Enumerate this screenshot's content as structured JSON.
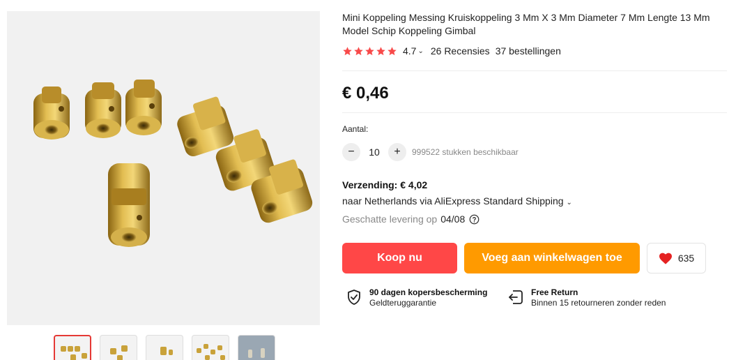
{
  "product": {
    "title": "Mini Koppeling Messing Kruiskoppeling 3 Mm X 3 Mm Diameter 7 Mm Lengte 13 Mm Model Schip Koppeling Gimbal",
    "rating": "4.7",
    "stars": 5,
    "reviews": "26 Recensies",
    "orders": "37 bestellingen",
    "price": "€ 0,46"
  },
  "quantity": {
    "label": "Aantal:",
    "minus": "−",
    "plus": "+",
    "value": "10",
    "available": "999522 stukken beschikbaar"
  },
  "shipping": {
    "title": "Verzending: € 4,02",
    "destination": "naar Netherlands via AliExpress Standard Shipping",
    "estimate_label": "Geschatte levering op",
    "estimate_date": "04/08"
  },
  "actions": {
    "buy_now": "Koop nu",
    "add_to_cart": "Voeg aan winkelwagen toe",
    "wishlist_count": "635"
  },
  "guarantees": [
    {
      "title": "90 dagen kopersbescherming",
      "subtitle": "Geldteruggarantie",
      "icon": "shield-check-icon"
    },
    {
      "title": "Free Return",
      "subtitle": "Binnen 15 retourneren zonder reden",
      "icon": "return-icon"
    }
  ],
  "colors": {
    "star": "#f84a4a",
    "buy_button": "#ff4747",
    "cart_button": "#ff9a00",
    "heart": "#e52222",
    "active_thumb_border": "#e53935",
    "brass": "#c9a23a"
  },
  "gallery": {
    "thumbnail_count": 5,
    "active_index": 0
  }
}
